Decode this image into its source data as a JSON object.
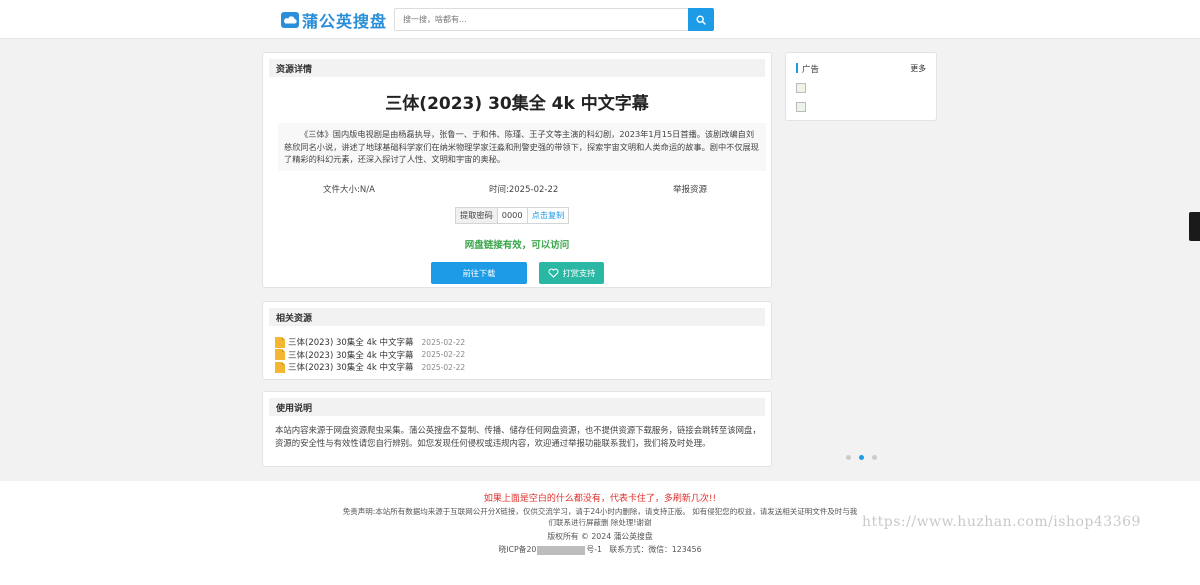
{
  "header": {
    "logo_text": "蒲公英搜盘",
    "search_placeholder": "搜一搜，啥都有..."
  },
  "detail": {
    "section_title": "资源详情",
    "title": "三体(2023) 30集全 4k 中文字幕",
    "description": "《三体》国内版电视剧是由杨磊执导，张鲁一、于和伟、陈瑾、王子文等主演的科幻剧，2023年1月15日首播。该剧改编自刘慈欣同名小说，讲述了地球基础科学家们在纳米物理学家汪淼和刑警史强的带领下，探索宇宙文明和人类命运的故事。剧中不仅展现了精彩的科幻元素，还深入探讨了人性、文明和宇宙的奥秘。",
    "file_size": "文件大小:N/A",
    "time": "时间:2025-02-22",
    "report": "举报资源",
    "code_label": "提取密码",
    "code_value": "0000",
    "copy_label": "点击复制",
    "valid_text": "网盘链接有效，可以访问",
    "download_label": "前往下载",
    "support_label": "打赏支持"
  },
  "related": {
    "section_title": "相关资源",
    "items": [
      {
        "title": "三体(2023) 30集全 4k 中文字幕",
        "date": "2025-02-22"
      },
      {
        "title": "三体(2023) 30集全 4k 中文字幕",
        "date": "2025-02-22"
      },
      {
        "title": "三体(2023) 30集全 4k 中文字幕",
        "date": "2025-02-22"
      }
    ]
  },
  "usage": {
    "section_title": "使用说明",
    "text": "本站内容来源于网盘资源爬虫采集。蒲公英搜盘不复制、传播、储存任何网盘资源，也不提供资源下载服务，链接会跳转至该网盘，资源的安全性与有效性请您自行辨别。如您发现任何侵权或违规内容，欢迎通过举报功能联系我们，我们将及时处理。"
  },
  "ad": {
    "title": "广告",
    "more": "更多"
  },
  "footer": {
    "warning": "如果上面是空白的什么都没有，代表卡住了，多刷新几次!!",
    "disclaimer": "免责声明:本站所有数据均来源于互联网公开分X链接，仅供交流学习，请于24小时内删除，请支持正版。 如有侵犯您的权益，请发送相关证明文件及时与我们联系进行屏蔽删 除处理!谢谢",
    "copyright": "版权所有 © 2024 蒲公英搜盘",
    "icp_prefix": "晓ICP备20",
    "icp_suffix": "号-1",
    "contact": "联系方式：微信：123456"
  },
  "watermark": "https://www.huzhan.com/ishop43369",
  "colors": {
    "brand": "#2a8fd8",
    "accent": "#1e9be6",
    "support": "#2ab8a4",
    "valid": "#3aa64a",
    "warning": "#e0302c"
  }
}
